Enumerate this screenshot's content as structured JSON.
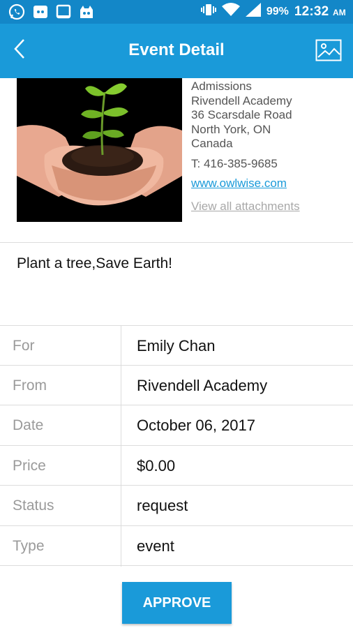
{
  "status_bar": {
    "battery_pct": "99%",
    "time": "12:32",
    "ampm": "AM"
  },
  "app_bar": {
    "title": "Event Detail"
  },
  "organizer": {
    "lines": [
      "Admissions",
      "Rivendell Academy",
      "36 Scarsdale Road",
      "North York, ON",
      "Canada"
    ],
    "phone": "T: 416-385-9685",
    "website": "www.owlwise.com",
    "attachments_link": "View all attachments"
  },
  "description": "Plant a tree,Save Earth!",
  "details": [
    {
      "label": "For",
      "value": "Emily Chan"
    },
    {
      "label": "From",
      "value": "Rivendell Academy"
    },
    {
      "label": "Date",
      "value": "October 06, 2017"
    },
    {
      "label": "Price",
      "value": "$0.00"
    },
    {
      "label": "Status",
      "value": "request"
    },
    {
      "label": "Type",
      "value": "event"
    }
  ],
  "actions": {
    "approve_label": "APPROVE"
  },
  "colors": {
    "status_bar": "#1387c8",
    "app_bar": "#1a9ad9",
    "accent": "#1a9ad9"
  },
  "icons": {
    "status_left": [
      "whatsapp-icon",
      "cat-app-icon",
      "tablet-icon",
      "android-icon"
    ],
    "status_right": [
      "vibrate-icon",
      "wifi-icon",
      "signal-icon"
    ],
    "app_bar": [
      "back-arrow-icon",
      "image-gallery-icon"
    ]
  }
}
